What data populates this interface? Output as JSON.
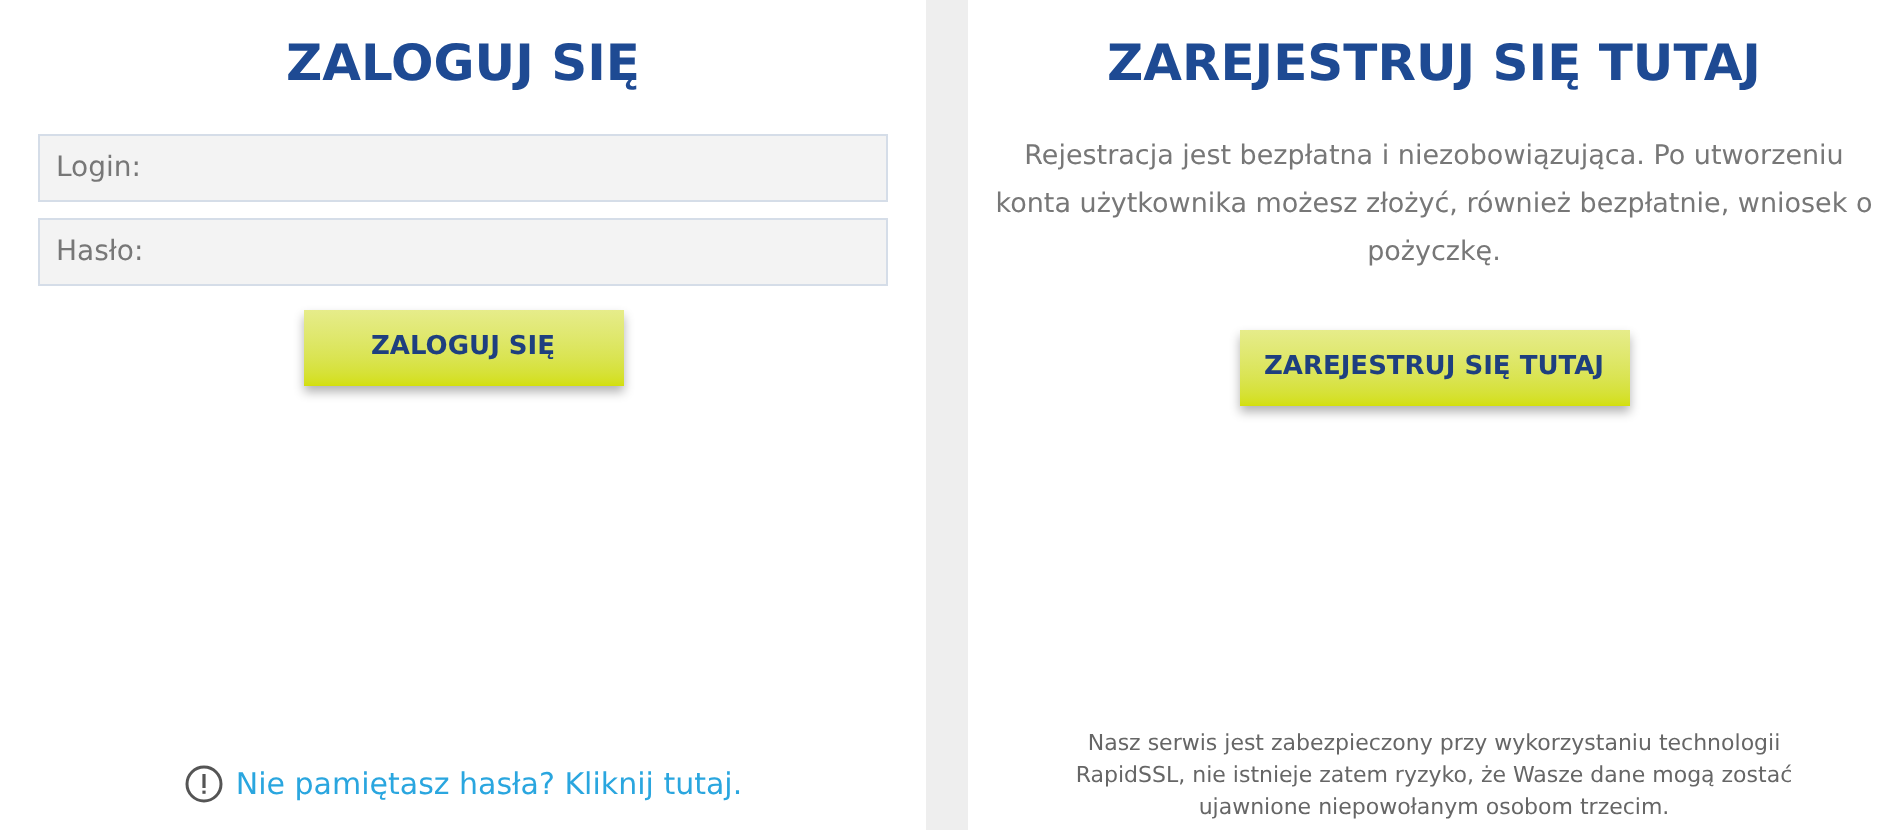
{
  "login": {
    "title": "ZALOGUJ SIĘ",
    "fields": [
      {
        "placeholder": "Login:"
      },
      {
        "placeholder": "Hasło:"
      }
    ],
    "button": "ZALOGUJ SIĘ",
    "forgot_link": "Nie pamiętasz hasła? Kliknij tutaj."
  },
  "register": {
    "title": "ZAREJESTRUJ SIĘ TUTAJ",
    "description": "Rejestracja jest bezpłatna i niezobowiązująca. Po utworzeniu konta użytkownika możesz złożyć, również bezpłatnie, wniosek o pożyczkę.",
    "button": "ZAREJESTRUJ SIĘ TUTAJ",
    "security_note": "Nasz serwis jest zabezpieczony przy wykorzystaniu technologii RapidSSL, nie istnieje zatem ryzyko, że Wasze dane mogą zostać ujawnione niepowołanym osobom trzecim."
  }
}
